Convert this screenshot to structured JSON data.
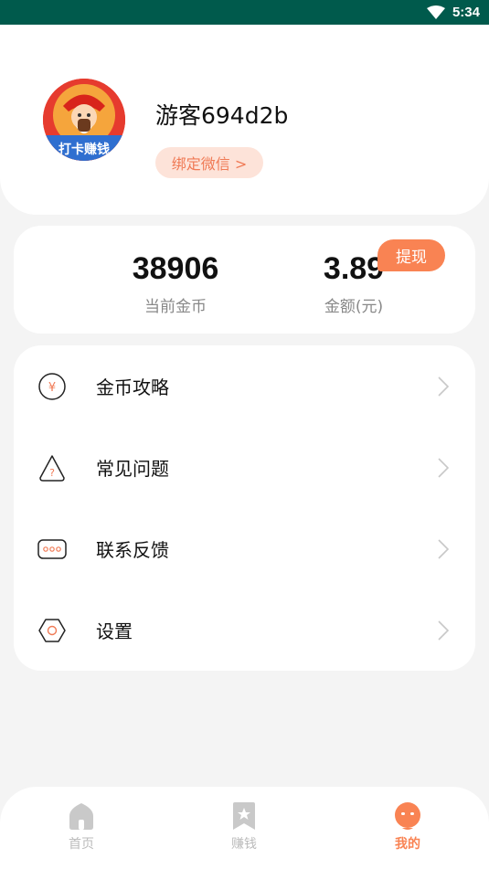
{
  "status_bar": {
    "time": "5:34",
    "background": "#005a4c"
  },
  "profile": {
    "username": "游客694d2b",
    "bind_button": "绑定微信 >",
    "avatar_banner": "打卡赚钱"
  },
  "wallet": {
    "coins_value": "38906",
    "coins_label": "当前金币",
    "amount_value": "3.89",
    "amount_label": "金额(元)",
    "withdraw_label": "提现",
    "accent": "#f98353"
  },
  "menu": {
    "items": [
      {
        "label": "金币攻略",
        "icon": "coin-icon"
      },
      {
        "label": "常见问题",
        "icon": "question-icon"
      },
      {
        "label": "联系反馈",
        "icon": "message-icon"
      },
      {
        "label": "设置",
        "icon": "settings-icon"
      }
    ]
  },
  "tabbar": {
    "tabs": [
      {
        "label": "首页",
        "icon": "home-icon",
        "active": false
      },
      {
        "label": "赚钱",
        "icon": "bookmark-star-icon",
        "active": false
      },
      {
        "label": "我的",
        "icon": "user-icon",
        "active": true
      }
    ]
  }
}
